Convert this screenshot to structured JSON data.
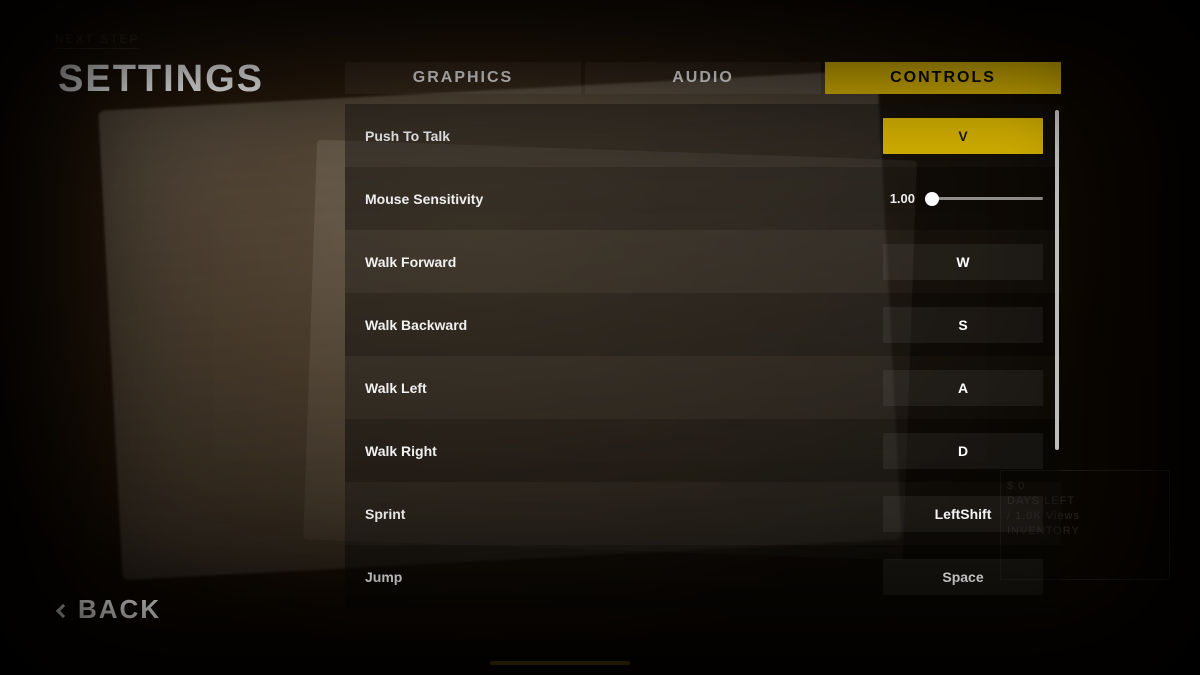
{
  "title": "SETTINGS",
  "back_label": "BACK",
  "accent_color": "#d8b400",
  "background_hints": {
    "next_step": "NEXT STEP",
    "hud_lines": [
      "$ 0",
      "DAYS LEFT",
      "/ 1.0K Views",
      "INVENTORY"
    ]
  },
  "tabs": [
    {
      "label": "GRAPHICS",
      "active": false
    },
    {
      "label": "AUDIO",
      "active": false
    },
    {
      "label": "CONTROLS",
      "active": true
    }
  ],
  "settings": [
    {
      "kind": "key",
      "label": "Push To Talk",
      "value": "V",
      "highlight": true
    },
    {
      "kind": "slider",
      "label": "Mouse Sensitivity",
      "value_text": "1.00",
      "value_pct": 6
    },
    {
      "kind": "key",
      "label": "Walk Forward",
      "value": "W"
    },
    {
      "kind": "key",
      "label": "Walk Backward",
      "value": "S"
    },
    {
      "kind": "key",
      "label": "Walk Left",
      "value": "A"
    },
    {
      "kind": "key",
      "label": "Walk Right",
      "value": "D"
    },
    {
      "kind": "key",
      "label": "Sprint",
      "value": "LeftShift"
    },
    {
      "kind": "key",
      "label": "Jump",
      "value": "Space"
    }
  ]
}
